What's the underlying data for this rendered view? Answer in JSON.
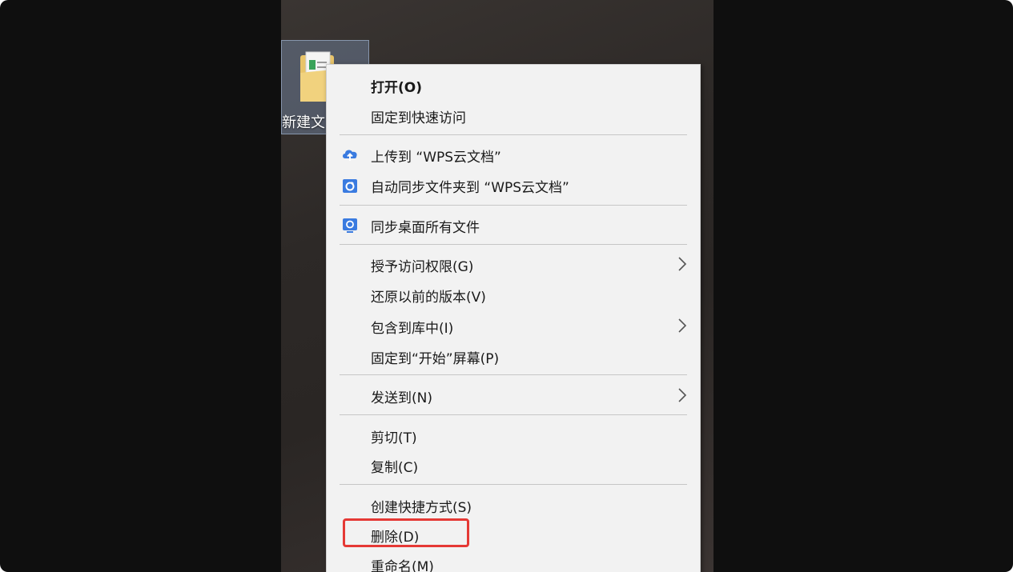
{
  "desktop": {
    "folder_label": "新建文"
  },
  "context_menu": {
    "open": "打开(O)",
    "pin_quick_access": "固定到快速访问",
    "upload_wps": "上传到 “WPS云文档”",
    "auto_sync_wps": "自动同步文件夹到 “WPS云文档”",
    "sync_desktop": "同步桌面所有文件",
    "grant_access": "授予访问权限(G)",
    "restore_versions": "还原以前的版本(V)",
    "include_library": "包含到库中(I)",
    "pin_start": "固定到“开始”屏幕(P)",
    "send_to": "发送到(N)",
    "cut": "剪切(T)",
    "copy": "复制(C)",
    "create_shortcut": "创建快捷方式(S)",
    "delete": "删除(D)",
    "rename": "重命名(M)"
  },
  "colors": {
    "accent_blue": "#3a7be0",
    "highlight_red": "#e53935",
    "menu_bg": "#f2f2f2"
  },
  "icons": {
    "upload": "cloud-upload-icon",
    "auto_sync": "folder-sync-icon",
    "sync_desktop": "desktop-sync-icon",
    "submenu": "chevron-right-icon"
  }
}
